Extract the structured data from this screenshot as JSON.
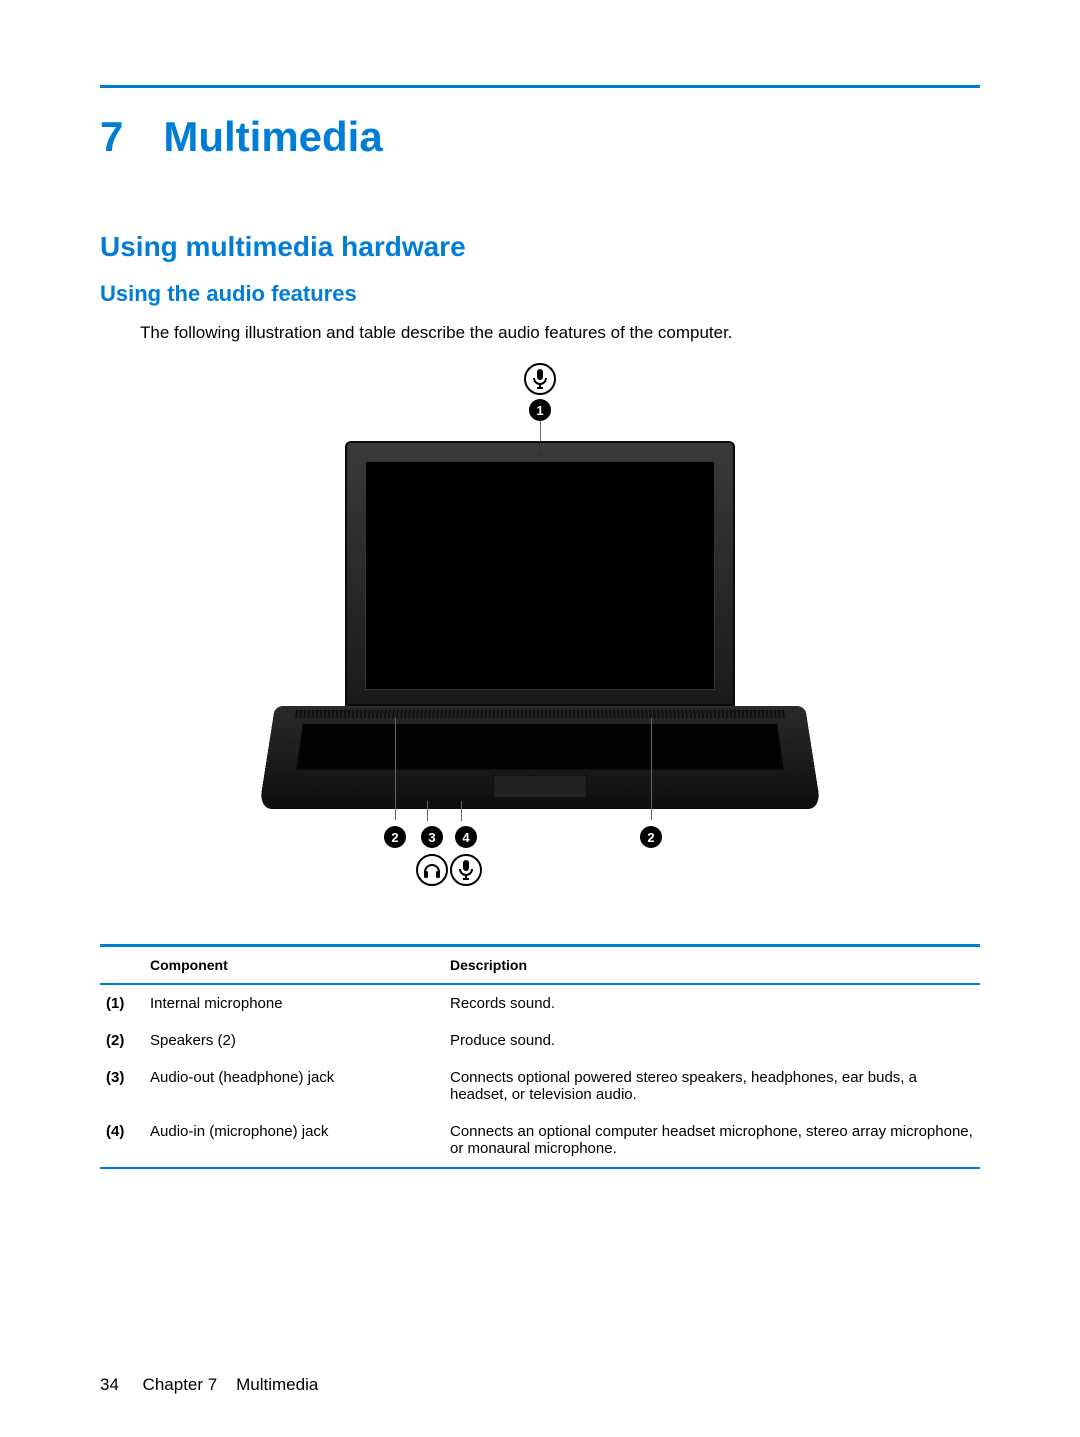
{
  "chapter": {
    "number": "7",
    "title": "Multimedia"
  },
  "sections": {
    "h2": "Using multimedia hardware",
    "h3": "Using the audio features",
    "intro": "The following illustration and table describe the audio features of the computer."
  },
  "callouts": {
    "c1": "1",
    "c2": "2",
    "c3": "3",
    "c4": "4"
  },
  "table": {
    "headers": {
      "component": "Component",
      "description": "Description"
    },
    "rows": [
      {
        "num": "(1)",
        "component": "Internal microphone",
        "description": "Records sound."
      },
      {
        "num": "(2)",
        "component": "Speakers (2)",
        "description": "Produce sound."
      },
      {
        "num": "(3)",
        "component": "Audio-out (headphone) jack",
        "description": "Connects optional powered stereo speakers, headphones, ear buds, a headset, or television audio."
      },
      {
        "num": "(4)",
        "component": "Audio-in (microphone) jack",
        "description": "Connects an optional computer headset microphone, stereo array microphone, or monaural microphone."
      }
    ]
  },
  "footer": {
    "page": "34",
    "chapter_label": "Chapter 7",
    "chapter_name": "Multimedia"
  }
}
